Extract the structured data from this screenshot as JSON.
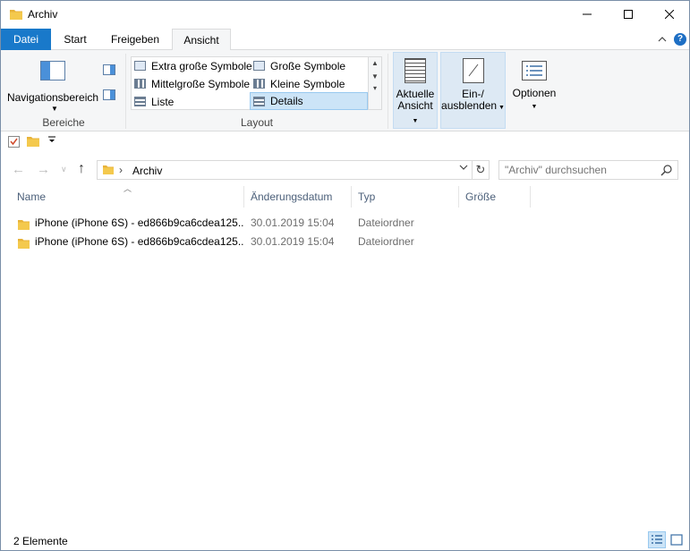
{
  "window": {
    "title": "Archiv"
  },
  "tabs": [
    {
      "label": "Datei"
    },
    {
      "label": "Start"
    },
    {
      "label": "Freigeben"
    },
    {
      "label": "Ansicht"
    }
  ],
  "ribbon": {
    "pane_group": {
      "nav_pane_label": "Navigationsbereich",
      "group_label": "Bereiche"
    },
    "layout_group": {
      "group_label": "Layout",
      "items": [
        {
          "label": "Extra große Symbole"
        },
        {
          "label": "Große Symbole"
        },
        {
          "label": "Mittelgroße Symbole"
        },
        {
          "label": "Kleine Symbole"
        },
        {
          "label": "Liste"
        },
        {
          "label": "Details",
          "selected": true
        }
      ]
    },
    "current_view": {
      "line1": "Aktuelle",
      "line2": "Ansicht"
    },
    "show_hide": {
      "line1": "Ein-/",
      "line2": "ausblenden"
    },
    "options": {
      "label": "Optionen"
    }
  },
  "address": {
    "breadcrumb": "Archiv"
  },
  "search": {
    "placeholder": "\"Archiv\" durchsuchen"
  },
  "columns": [
    {
      "label": "Name"
    },
    {
      "label": "Änderungsdatum"
    },
    {
      "label": "Typ"
    },
    {
      "label": "Größe"
    }
  ],
  "rows": [
    {
      "name": "iPhone (iPhone 6S) - ed866b9ca6cdea125...",
      "date": "30.01.2019 15:04",
      "type": "Dateiordner"
    },
    {
      "name": "iPhone (iPhone 6S) - ed866b9ca6cdea125...",
      "date": "30.01.2019 15:04",
      "type": "Dateiordner"
    }
  ],
  "status": {
    "count": "2 Elemente"
  },
  "colors": {
    "accent": "#1979ca",
    "folder": "#f4c94d",
    "selection": "#cce4f7"
  }
}
